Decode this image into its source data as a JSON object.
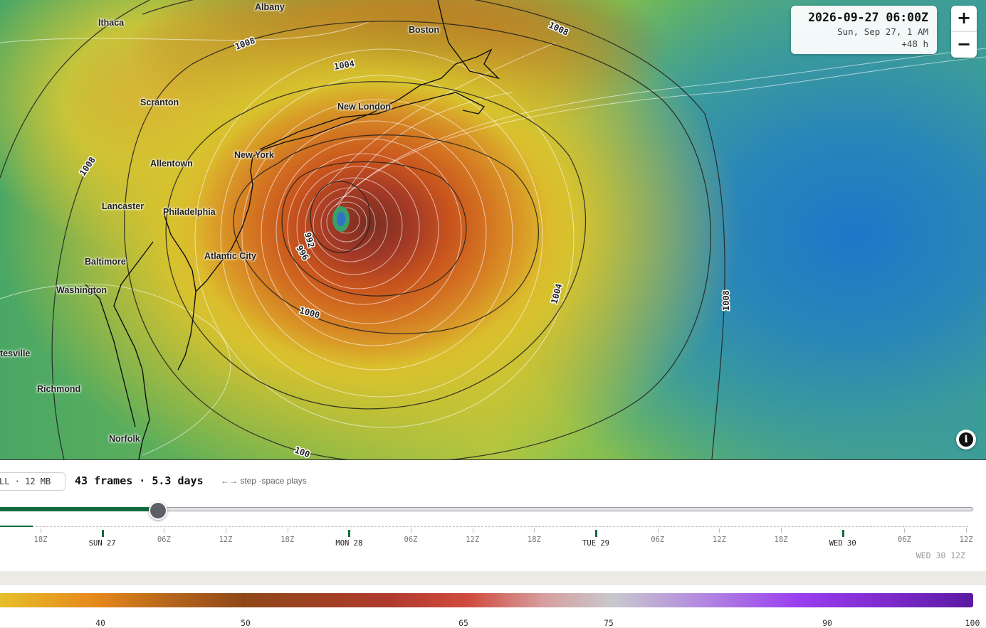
{
  "map": {
    "cities": [
      {
        "name": "Ithaca"
      },
      {
        "name": "Albany"
      },
      {
        "name": "Boston"
      },
      {
        "name": "Scranton"
      },
      {
        "name": "New London"
      },
      {
        "name": "Allentown"
      },
      {
        "name": "New York"
      },
      {
        "name": "Lancaster"
      },
      {
        "name": "Philadelphia"
      },
      {
        "name": "Atlantic City"
      },
      {
        "name": "Baltimore"
      },
      {
        "name": "Washington"
      },
      {
        "name": "tesville"
      },
      {
        "name": "Richmond"
      },
      {
        "name": "Norfolk"
      }
    ],
    "isobar_labels": [
      "1008",
      "1008",
      "1004",
      "1008",
      "992",
      "996",
      "1000",
      "1004",
      "1008",
      "100"
    ],
    "colors": {
      "storm_core": "#7a2e22",
      "ocean_calm": "#1e77c8",
      "land_low": "#4aa765",
      "isobar": "#222222",
      "streamline": "#ffffff"
    }
  },
  "timebox": {
    "utc": "2026-09-27 06:00Z",
    "local": "Sun, Sep 27, 1 AM",
    "lead": "+48 h"
  },
  "zoom": {
    "in": "+",
    "out": "−"
  },
  "info_icon": "i",
  "controls": {
    "chip": "LL · 12 MB",
    "frames": "43 frames · 5.3 days",
    "hint": "←→ step ·space plays",
    "progress_fraction": 0.1625
  },
  "timeline": {
    "ticks": [
      {
        "label": "18Z",
        "day": false
      },
      {
        "label": "SUN 27",
        "day": true
      },
      {
        "label": "06Z",
        "day": false
      },
      {
        "label": "12Z",
        "day": false
      },
      {
        "label": "18Z",
        "day": false
      },
      {
        "label": "MON 28",
        "day": true
      },
      {
        "label": "06Z",
        "day": false
      },
      {
        "label": "12Z",
        "day": false
      },
      {
        "label": "18Z",
        "day": false
      },
      {
        "label": "TUE 29",
        "day": true
      },
      {
        "label": "06Z",
        "day": false
      },
      {
        "label": "12Z",
        "day": false
      },
      {
        "label": "18Z",
        "day": false
      },
      {
        "label": "WED 30",
        "day": true
      },
      {
        "label": "06Z",
        "day": false
      },
      {
        "label": "12Z",
        "day": false
      }
    ],
    "end_label": "WED 30 12Z",
    "accent": "#0f6b3c"
  },
  "legend": {
    "ticks": [
      "40",
      "50",
      "65",
      "75",
      "90",
      "100"
    ]
  }
}
